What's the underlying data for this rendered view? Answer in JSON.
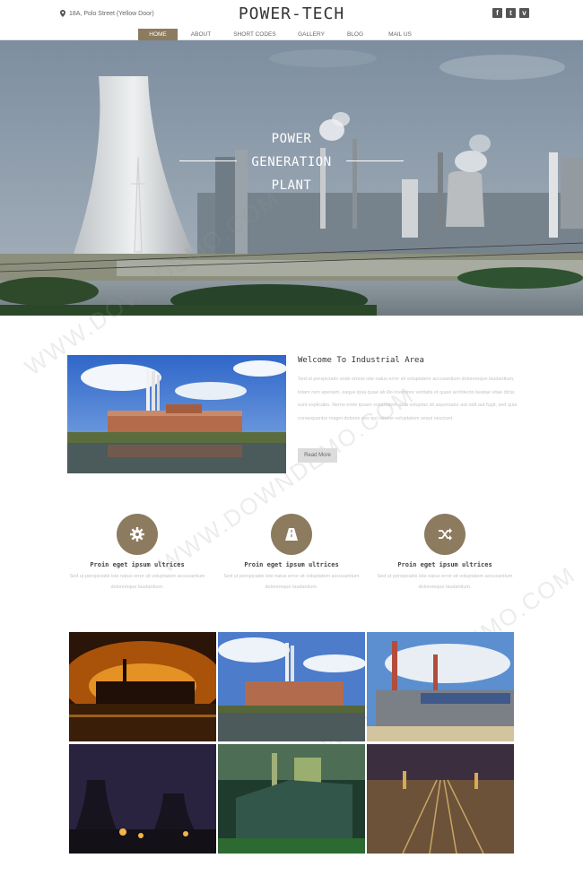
{
  "header": {
    "address": "18A, Polo Street (Yellow Door)",
    "logo": "POWER-TECH",
    "social": [
      {
        "icon": "facebook-icon",
        "glyph": "f"
      },
      {
        "icon": "twitter-icon",
        "glyph": "t"
      },
      {
        "icon": "vimeo-icon",
        "glyph": "v"
      }
    ]
  },
  "nav": {
    "items": [
      {
        "label": "HOME",
        "active": true
      },
      {
        "label": "ABOUT",
        "active": false
      },
      {
        "label": "SHORT CODES",
        "active": false
      },
      {
        "label": "GALLERY",
        "active": false
      },
      {
        "label": "BLOG",
        "active": false
      },
      {
        "label": "MAIL US",
        "active": false
      }
    ]
  },
  "hero": {
    "line1": "POWER",
    "line2": "GENERATION",
    "line3": "PLANT"
  },
  "welcome": {
    "title": "Welcome To Industrial Area",
    "text": "Sed ut perspiciatis unde omnis iste natus error sit voluptatem accusantium doloremque laudantium, totam rem aperiam, eaque ipsa quae ab illo inventore veritatis et quasi architecto beatae vitae dicta sunt explicabo. Nemo enim ipsam voluptatem quia voluptas sit aspernatur aut odit aut fugit, sed quia consequuntur magni dolores eos qui ratione voluptatem sequi nesciunt.",
    "read_more": "Read More"
  },
  "features": [
    {
      "icon": "gear-icon",
      "title": "Proin eget ipsum ultrices",
      "text": "Sed ut perspiciatis iste natus error sit voluptatem accusantium doloremque laudantium."
    },
    {
      "icon": "road-icon",
      "title": "Proin eget ipsum ultrices",
      "text": "Sed ut perspiciatis iste natus error sit voluptatem accusantium doloremque laudantium."
    },
    {
      "icon": "shuffle-icon",
      "title": "Proin eget ipsum ultrices",
      "text": "Sed ut perspiciatis iste natus error sit voluptatem accusantium doloremque laudantium."
    }
  ],
  "colors": {
    "accent": "#8c7b5f",
    "text_light": "#c4c4c4"
  },
  "watermark": "WWW.DOWNDEMO.COM"
}
